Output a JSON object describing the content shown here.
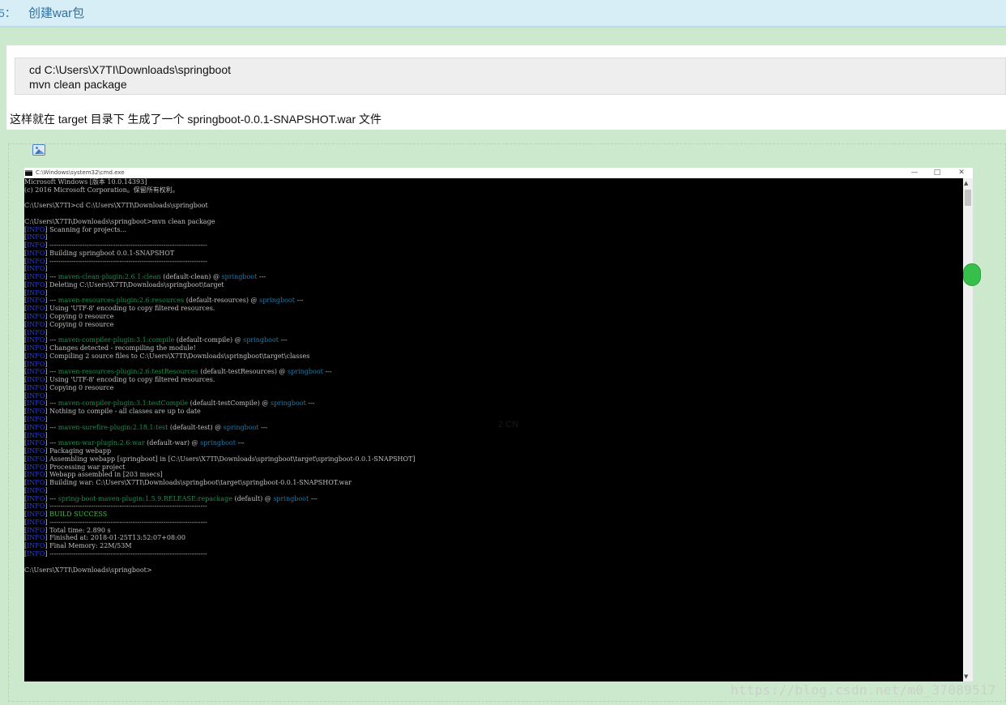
{
  "step": {
    "number": "5：",
    "title": "创建war包"
  },
  "code": {
    "lines": [
      "cd C:\\Users\\X7TI\\Downloads\\springboot",
      "mvn clean package"
    ]
  },
  "description": "这样就在 target 目录下 生成了一个 springboot-0.0.1-SNAPSHOT.war 文件",
  "image_icon": "image-icon",
  "cmd_window": {
    "title": "C:\\Windows\\system32\\cmd.exe",
    "buttons": {
      "minimize": "—",
      "maximize": "□",
      "close": "✕"
    },
    "scroll_up": "▲",
    "scroll_down": "▼",
    "info_tag": "INFO",
    "lines": [
      [
        {
          "t": "Microsoft Windows [版本 10.0.14393]"
        }
      ],
      [
        {
          "t": "(c) 2016 Microsoft Corporation。保留所有权利。"
        }
      ],
      [
        {
          "t": ""
        }
      ],
      [
        {
          "t": "C:\\Users\\X7TI>cd C:\\Users\\X7TI\\Downloads\\springboot"
        }
      ],
      [
        {
          "t": ""
        }
      ],
      [
        {
          "t": "C:\\Users\\X7TI\\Downloads\\springboot>mvn clean package"
        }
      ],
      [
        {
          "info": true
        },
        {
          "t": " Scanning for projects..."
        }
      ],
      [
        {
          "info": true
        }
      ],
      [
        {
          "info": true
        },
        {
          "t": " ------------------------------------------------------------------------"
        }
      ],
      [
        {
          "info": true
        },
        {
          "t": " Building springboot 0.0.1-SNAPSHOT"
        }
      ],
      [
        {
          "info": true
        },
        {
          "t": " ------------------------------------------------------------------------"
        }
      ],
      [
        {
          "info": true
        }
      ],
      [
        {
          "info": true
        },
        {
          "t": " --- "
        },
        {
          "t": "maven-clean-plugin:2.6.1:clean",
          "c": "plugin"
        },
        {
          "t": " (default-clean) @ "
        },
        {
          "t": "springboot",
          "c": "proj"
        },
        {
          "t": " ---"
        }
      ],
      [
        {
          "info": true
        },
        {
          "t": " Deleting C:\\Users\\X7TI\\Downloads\\springboot\\target"
        }
      ],
      [
        {
          "info": true
        }
      ],
      [
        {
          "info": true
        },
        {
          "t": " --- "
        },
        {
          "t": "maven-resources-plugin:2.6:resources",
          "c": "plugin"
        },
        {
          "t": " (default-resources) @ "
        },
        {
          "t": "springboot",
          "c": "proj"
        },
        {
          "t": " ---"
        }
      ],
      [
        {
          "info": true
        },
        {
          "t": " Using 'UTF-8' encoding to copy filtered resources."
        }
      ],
      [
        {
          "info": true
        },
        {
          "t": " Copying 0 resource"
        }
      ],
      [
        {
          "info": true
        },
        {
          "t": " Copying 0 resource"
        }
      ],
      [
        {
          "info": true
        }
      ],
      [
        {
          "info": true
        },
        {
          "t": " --- "
        },
        {
          "t": "maven-compiler-plugin:3.1:compile",
          "c": "plugin"
        },
        {
          "t": " (default-compile) @ "
        },
        {
          "t": "springboot",
          "c": "proj"
        },
        {
          "t": " ---"
        }
      ],
      [
        {
          "info": true
        },
        {
          "t": " Changes detected - recompiling the module!"
        }
      ],
      [
        {
          "info": true
        },
        {
          "t": " Compiling 2 source files to C:\\Users\\X7TI\\Downloads\\springboot\\target\\classes"
        }
      ],
      [
        {
          "info": true
        }
      ],
      [
        {
          "info": true
        },
        {
          "t": " --- "
        },
        {
          "t": "maven-resources-plugin:2.6:testResources",
          "c": "plugin"
        },
        {
          "t": " (default-testResources) @ "
        },
        {
          "t": "springboot",
          "c": "proj"
        },
        {
          "t": " ---"
        }
      ],
      [
        {
          "info": true
        },
        {
          "t": " Using 'UTF-8' encoding to copy filtered resources."
        }
      ],
      [
        {
          "info": true
        },
        {
          "t": " Copying 0 resource"
        }
      ],
      [
        {
          "info": true
        }
      ],
      [
        {
          "info": true
        },
        {
          "t": " --- "
        },
        {
          "t": "maven-compiler-plugin:3.1:testCompile",
          "c": "plugin"
        },
        {
          "t": " (default-testCompile) @ "
        },
        {
          "t": "springboot",
          "c": "proj"
        },
        {
          "t": " ---"
        }
      ],
      [
        {
          "info": true
        },
        {
          "t": " Nothing to compile - all classes are up to date"
        }
      ],
      [
        {
          "info": true
        }
      ],
      [
        {
          "info": true
        },
        {
          "t": " --- "
        },
        {
          "t": "maven-surefire-plugin:2.18.1:test",
          "c": "plugin"
        },
        {
          "t": " (default-test) @ "
        },
        {
          "t": "springboot",
          "c": "proj"
        },
        {
          "t": " ---"
        }
      ],
      [
        {
          "info": true
        }
      ],
      [
        {
          "info": true
        },
        {
          "t": " --- "
        },
        {
          "t": "maven-war-plugin:2.6:war",
          "c": "plugin"
        },
        {
          "t": " (default-war) @ "
        },
        {
          "t": "springboot",
          "c": "proj"
        },
        {
          "t": " ---"
        }
      ],
      [
        {
          "info": true
        },
        {
          "t": " Packaging webapp"
        }
      ],
      [
        {
          "info": true
        },
        {
          "t": " Assembling webapp [springboot] in [C:\\Users\\X7TI\\Downloads\\springboot\\target\\springboot-0.0.1-SNAPSHOT]"
        }
      ],
      [
        {
          "info": true
        },
        {
          "t": " Processing war project"
        }
      ],
      [
        {
          "info": true
        },
        {
          "t": " Webapp assembled in [203 msecs]"
        }
      ],
      [
        {
          "info": true
        },
        {
          "t": " Building war: C:\\Users\\X7TI\\Downloads\\springboot\\target\\springboot-0.0.1-SNAPSHOT.war"
        }
      ],
      [
        {
          "info": true
        }
      ],
      [
        {
          "info": true
        },
        {
          "t": " --- "
        },
        {
          "t": "spring-boot-maven-plugin:1.5.9.RELEASE:repackage",
          "c": "plugin"
        },
        {
          "t": " (default) @ "
        },
        {
          "t": "springboot",
          "c": "proj"
        },
        {
          "t": " ---"
        }
      ],
      [
        {
          "info": true
        },
        {
          "t": " ------------------------------------------------------------------------"
        }
      ],
      [
        {
          "info": true
        },
        {
          "t": " "
        },
        {
          "t": "BUILD SUCCESS",
          "c": "success"
        }
      ],
      [
        {
          "info": true
        },
        {
          "t": " ------------------------------------------------------------------------"
        }
      ],
      [
        {
          "info": true
        },
        {
          "t": " Total time: 2.890 s"
        }
      ],
      [
        {
          "info": true
        },
        {
          "t": " Finished at: 2018-01-25T13:52:07+08:00"
        }
      ],
      [
        {
          "info": true
        },
        {
          "t": " Final Memory: 22M/53M"
        }
      ],
      [
        {
          "info": true
        },
        {
          "t": " ------------------------------------------------------------------------"
        }
      ],
      [
        {
          "t": ""
        }
      ],
      [
        {
          "t": "C:\\Users\\X7TI\\Downloads\\springboot>"
        }
      ]
    ]
  },
  "faint_text": "2  CN",
  "watermark": "https://blog.csdn.net/m0_37089517",
  "colors": {
    "page_bg": "#cde9cd",
    "info_tag": "#2a3ee0",
    "plugin": "#1e8e4f",
    "project": "#1f79a8",
    "success": "#3fbf3f"
  }
}
